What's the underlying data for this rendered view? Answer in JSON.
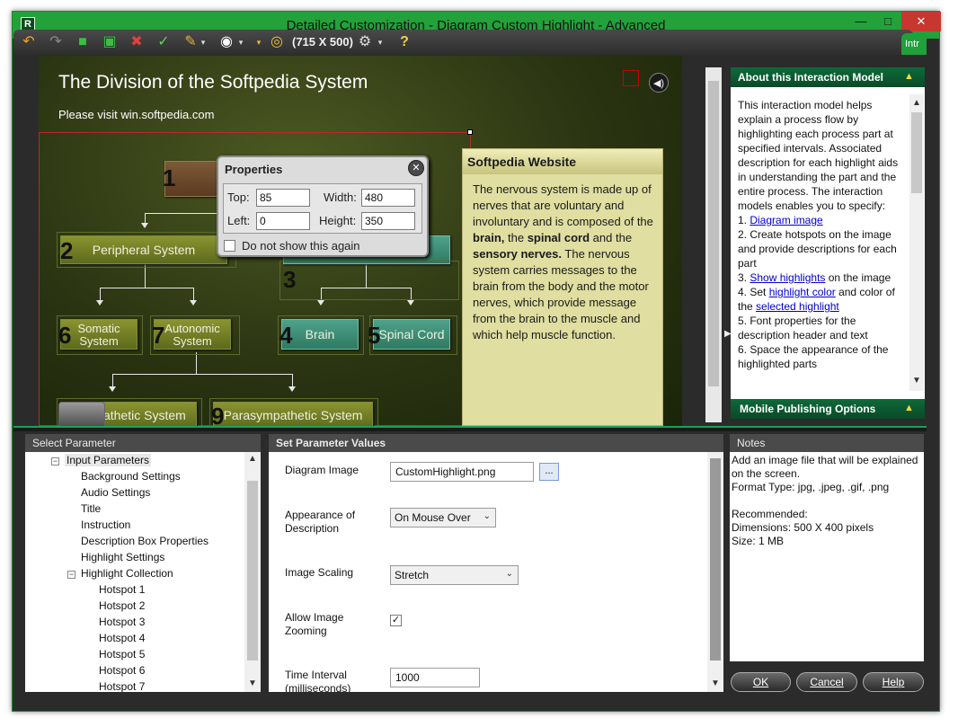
{
  "window": {
    "title": "Detailed Customization - Diagram Custom Highlight - Advanced",
    "app_icon": "R",
    "min": "▭",
    "max": "□",
    "close": "✕"
  },
  "toolbar": {
    "size_label": "(715 X 500)",
    "icons": [
      "undo-icon",
      "redo-icon",
      "save-icon",
      "save-all-icon",
      "delete-icon",
      "spellcheck-icon",
      "theme-icon",
      "preview-icon",
      "target-icon",
      "settings-icon",
      "help-icon"
    ],
    "intro_tab": "Intr"
  },
  "diagram": {
    "title": "The Division of the Softpedia System",
    "subtitle": "Please visit win.softpedia.com",
    "nodes": {
      "n1": "1",
      "peripheral": "Peripheral System",
      "central": "Central System",
      "somatic": "Somatic System",
      "autonomic": "Autonomic System",
      "brain": "Brain",
      "spinal": "Spinal Cord",
      "sympathetic": "Sympathetic System",
      "parasympathetic": "Parasympathetic System"
    },
    "numbers": {
      "n1": "1",
      "n2": "2",
      "n3": "3",
      "n4": "4",
      "n5": "5",
      "n6": "6",
      "n7": "7",
      "n9": "9"
    }
  },
  "description": {
    "header": "Softpedia Website",
    "body_1": "The nervous system is made up of nerves that are voluntary and involuntary and is composed of the ",
    "bold_1": "brain,",
    "body_2": " the ",
    "bold_2": "spinal cord",
    "body_3": " and the ",
    "bold_3": "sensory nerves.",
    "body_4": " The nervous system carries messages to the brain from the body and the motor nerves, which provide message from the brain to the muscle and which help muscle function."
  },
  "properties": {
    "title": "Properties",
    "top_label": "Top:",
    "top_value": "85",
    "width_label": "Width:",
    "width_value": "480",
    "left_label": "Left:",
    "left_value": "0",
    "height_label": "Height:",
    "height_value": "350",
    "checkbox_label": "Do not show this again"
  },
  "about": {
    "header": "About this Interaction Model",
    "intro": "This interaction model helps explain a process flow by highlighting each process part at specified intervals. Associated description for each highlight aids in understanding the part and the entire process. The interaction models enables you to specify:",
    "item1_prefix": "1. ",
    "item1_link": "Diagram image",
    "item2": "2. Create hotspots on the image and provide descriptions for each part",
    "item3_prefix": "3. ",
    "item3_link": "Show highlights",
    "item3_suffix": " on the image",
    "item4_prefix": "4. Set ",
    "item4_link": "highlight color",
    "item4_mid": " and color of the ",
    "item4_link2": "selected highlight",
    "item5": "5. Font properties for the description header and text",
    "item6": "6. Space the appearance of the highlighted parts",
    "mobile_header": "Mobile Publishing Options"
  },
  "select_parameter": {
    "header": "Select Parameter",
    "items": [
      {
        "label": "Input Parameters",
        "indent": 0,
        "toggle": "−"
      },
      {
        "label": "Background Settings",
        "indent": 1
      },
      {
        "label": "Audio Settings",
        "indent": 1
      },
      {
        "label": "Title",
        "indent": 1
      },
      {
        "label": "Instruction",
        "indent": 1
      },
      {
        "label": "Description Box Properties",
        "indent": 1
      },
      {
        "label": "Highlight Settings",
        "indent": 1
      },
      {
        "label": "Highlight Collection",
        "indent": 1,
        "toggle": "−"
      },
      {
        "label": "Hotspot 1",
        "indent": 2
      },
      {
        "label": "Hotspot 2",
        "indent": 2
      },
      {
        "label": "Hotspot 3",
        "indent": 2
      },
      {
        "label": "Hotspot 4",
        "indent": 2
      },
      {
        "label": "Hotspot 5",
        "indent": 2
      },
      {
        "label": "Hotspot 6",
        "indent": 2
      },
      {
        "label": "Hotspot 7",
        "indent": 2
      }
    ]
  },
  "set_parameter": {
    "header": "Set Parameter Values",
    "diagram_image_label": "Diagram Image",
    "diagram_image_value": "CustomHighlight.png",
    "browse_label": "...",
    "appearance_label": "Appearance of Description",
    "appearance_value": "On Mouse Over",
    "scaling_label": "Image Scaling",
    "scaling_value": "Stretch",
    "zoom_label": "Allow Image Zooming",
    "zoom_checked": true,
    "interval_label": "Time Interval (milliseconds)",
    "interval_value": "1000"
  },
  "notes": {
    "header": "Notes",
    "line1": "Add an image file that will be explained on the screen.",
    "line2": "Format Type: jpg, .jpeg, .gif, .png",
    "line3": "Recommended:",
    "line4": "Dimensions:  500 X 400 pixels",
    "line5": "Size: 1 MB"
  },
  "buttons": {
    "ok": "OK",
    "cancel": "Cancel",
    "help": "Help"
  },
  "colors": {
    "title_bar": "#23a13a",
    "panel_header": "#0e6a3a",
    "node_olive": "#8a9430",
    "node_teal": "#4fa28a"
  }
}
